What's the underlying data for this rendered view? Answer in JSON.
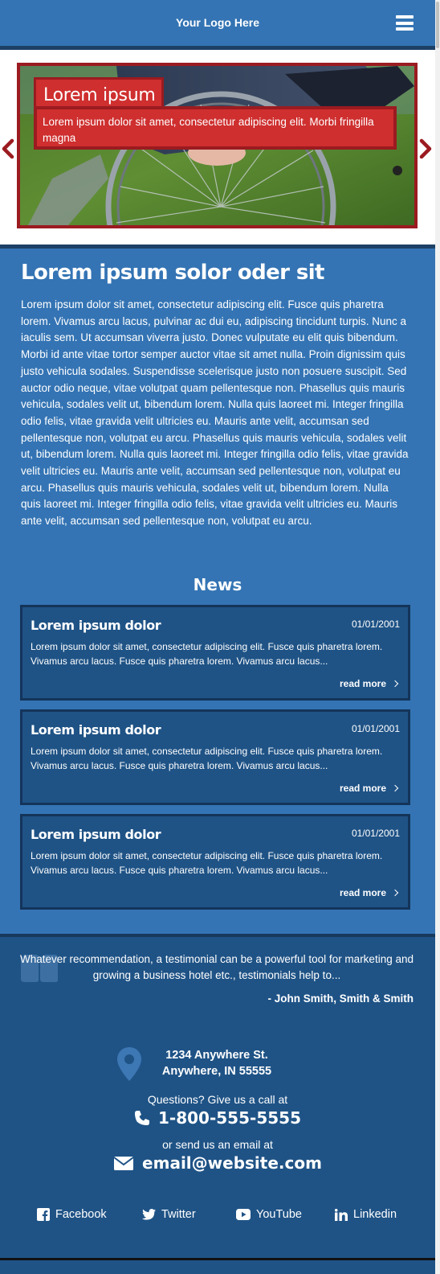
{
  "header": {
    "logo": "Your Logo Here"
  },
  "slider": {
    "caption_title": "Lorem ipsum",
    "caption_body": "Lorem ipsum dolor sit amet, consectetur adipiscing elit. Morbi fringilla magna"
  },
  "main": {
    "title": "Lorem ipsum solor oder sit",
    "body": "Lorem ipsum dolor sit amet, consectetur adipiscing elit. Fusce quis pharetra lorem. Vivamus arcu lacus, pulvinar ac dui eu, adipiscing tincidunt turpis. Nunc a iaculis sem. Ut accumsan viverra justo. Donec vulputate eu elit quis bibendum. Morbi id ante vitae tortor semper auctor vitae sit amet nulla. Proin dignissim quis justo vehicula sodales. Suspendisse scelerisque justo non posuere suscipit. Sed auctor odio neque, vitae volutpat quam pellentesque non. Phasellus quis mauris vehicula, sodales velit ut, bibendum lorem. Nulla quis laoreet mi. Integer fringilla odio felis, vitae gravida velit ultricies eu. Mauris ante velit, accumsan sed pellentesque non, volutpat eu arcu. Phasellus quis mauris vehicula, sodales velit ut, bibendum lorem. Nulla quis laoreet mi. Integer fringilla odio felis, vitae gravida velit ultricies eu. Mauris ante velit, accumsan sed pellentesque non, volutpat eu arcu. Phasellus quis mauris vehicula, sodales velit ut, bibendum lorem. Nulla quis laoreet mi. Integer fringilla odio felis, vitae gravida velit ultricies eu. Mauris ante velit, accumsan sed pellentesque non, volutpat eu arcu."
  },
  "news": {
    "heading": "News",
    "items": [
      {
        "title": "Lorem ipsum dolor",
        "date": "01/01/2001",
        "text": "Lorem ipsum dolor sit amet, consectetur adipiscing elit. Fusce quis pharetra lorem. Vivamus arcu lacus. Fusce quis pharetra lorem. Vivamus arcu lacus...",
        "more": "read more"
      },
      {
        "title": "Lorem ipsum dolor",
        "date": "01/01/2001",
        "text": "Lorem ipsum dolor sit amet, consectetur adipiscing elit. Fusce quis pharetra lorem. Vivamus arcu lacus. Fusce quis pharetra lorem. Vivamus arcu lacus...",
        "more": "read more"
      },
      {
        "title": "Lorem ipsum dolor",
        "date": "01/01/2001",
        "text": "Lorem ipsum dolor sit amet, consectetur adipiscing elit. Fusce quis pharetra lorem. Vivamus arcu lacus. Fusce quis pharetra lorem. Vivamus arcu lacus...",
        "more": "read more"
      }
    ]
  },
  "footer": {
    "testimonial": "Whatever recommendation, a testimonial can be a powerful tool for marketing and growing a business hotel etc., testimonials help to...",
    "testimonial_author": "- John Smith, Smith & Smith",
    "address_line1": "1234 Anywhere St.",
    "address_line2": "Anywhere, IN 55555",
    "call_label": "Questions? Give us a call at",
    "phone": "1-800-555-5555",
    "email_label": "or send us an email at",
    "email": "email@website.com",
    "social": {
      "facebook": "Facebook",
      "twitter": "Twitter",
      "youtube": "YouTube",
      "linkedin": "Linkedin"
    }
  },
  "colors": {
    "header_blue": "#3474b4",
    "dark_blue": "#1f5386",
    "accent_red": "#cf2f2f",
    "border_red": "#9b1b20"
  },
  "icons": [
    "menu-icon",
    "arrow-left-icon",
    "arrow-right-icon",
    "quote-icon",
    "map-pin-icon",
    "phone-icon",
    "envelope-icon",
    "facebook-icon",
    "twitter-icon",
    "youtube-icon",
    "linkedin-icon",
    "chevron-right-icon"
  ]
}
